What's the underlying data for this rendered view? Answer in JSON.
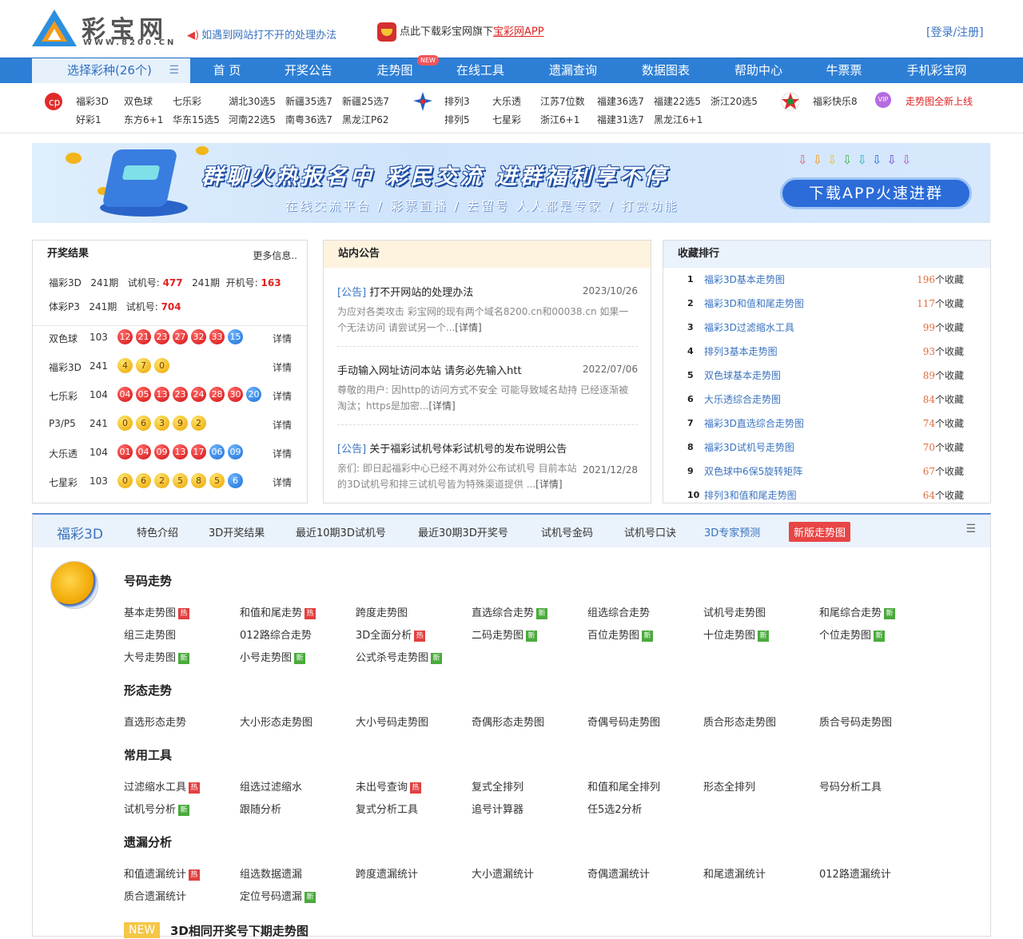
{
  "header": {
    "logo_name": "彩宝网",
    "logo_url": "WWW.8200.CN",
    "notice": "如遇到网站打不开的处理办法",
    "app_text": "点此下载彩宝网旗下",
    "app_link": "宝彩网APP",
    "login": "[登录/注册]"
  },
  "nav": {
    "selector": "选择彩种(26个)",
    "items": [
      "首 页",
      "开奖公告",
      "走势图",
      "在线工具",
      "遗漏查询",
      "数据图表",
      "帮助中心",
      "牛票票",
      "手机彩宝网"
    ],
    "new_badge": "NEW"
  },
  "lottery_row": {
    "group1": [
      [
        "福彩3D",
        "双色球",
        "七乐彩",
        "湖北30选5",
        "新疆35选7",
        "新疆25选7"
      ],
      [
        "好彩1",
        "东方6+1",
        "华东15选5",
        "河南22选5",
        "南粤36选7",
        "黑龙江P62"
      ]
    ],
    "group2": [
      [
        "排列3",
        "大乐透",
        "江苏7位数",
        "福建36选7",
        "福建22选5",
        "浙江20选5"
      ],
      [
        "排列5",
        "七星彩",
        "浙江6+1",
        "福建31选7",
        "黑龙江6+1"
      ]
    ],
    "group3": [
      "福彩快乐8"
    ],
    "promo": "走势图全新上线",
    "vip": "VIP"
  },
  "banner": {
    "title": "群聊火热报名中  彩民交流  进群福利享不停",
    "subtitle": "在线交流平台 / 彩票直播 / 去留号 人人都是专家 / 打赏功能",
    "cta": "下载APP火速进群"
  },
  "results": {
    "title": "开奖结果",
    "more": "更多信息..",
    "line1": {
      "name": "福彩3D",
      "issue1": "241期",
      "label1": "试机号:",
      "val1": "477",
      "issue2": "241期",
      "label2": "开机号:",
      "val2": "163"
    },
    "line2": {
      "name": "体彩P3",
      "issue1": "241期",
      "label1": "试机号:",
      "val1": "704"
    },
    "draws": [
      {
        "name": "双色球",
        "issue": "103",
        "red": [
          "12",
          "21",
          "23",
          "27",
          "32",
          "33"
        ],
        "blue": [
          "15"
        ],
        "style": "red",
        "detail": "详情"
      },
      {
        "name": "福彩3D",
        "issue": "241",
        "red": [
          "4",
          "7",
          "0"
        ],
        "blue": [],
        "style": "yel",
        "detail": "详情"
      },
      {
        "name": "七乐彩",
        "issue": "104",
        "red": [
          "04",
          "05",
          "13",
          "23",
          "24",
          "28",
          "30"
        ],
        "blue": [
          "20"
        ],
        "style": "red",
        "detail": "详情"
      },
      {
        "name": "P3/P5",
        "issue": "241",
        "red": [
          "0",
          "6",
          "3",
          "9",
          "2"
        ],
        "blue": [],
        "style": "yel",
        "detail": "详情"
      },
      {
        "name": "大乐透",
        "issue": "104",
        "red": [
          "01",
          "04",
          "09",
          "13",
          "17"
        ],
        "blue": [
          "06",
          "09"
        ],
        "style": "red",
        "detail": "详情"
      },
      {
        "name": "七星彩",
        "issue": "103",
        "red": [
          "0",
          "6",
          "2",
          "5",
          "8",
          "5"
        ],
        "blue": [
          "6"
        ],
        "style": "yel",
        "detail": "详情"
      }
    ]
  },
  "notices": {
    "title": "站内公告",
    "articles": [
      {
        "prefix": "[公告]",
        "title": "打不开网站的处理办法",
        "date": "2023/10/26",
        "excerpt": "为应对各类攻击 彩宝网的现有两个域名8200.cn和00038.cn 如果一个无法访问 请尝试另一个...",
        "link": "[详情]"
      },
      {
        "prefix": "",
        "title": "手动输入网址访问本站 请务必先输入htt",
        "date": "2022/07/06",
        "excerpt": "尊敬的用户: 因http的访问方式不安全 可能导致域名劫持 已经逐渐被淘汰；https是加密...",
        "link": "[详情]"
      },
      {
        "prefix": "[公告]",
        "title": "关于福彩试机号体彩试机号的发布说明公告",
        "date": "2021/12/28",
        "excerpt": "亲们:  即日起福彩中心已经不再对外公布试机号 目前本站的3D试机号和排三试机号皆为特殊渠道提供 ...",
        "link": "[详情]"
      }
    ]
  },
  "ranking": {
    "title": "收藏排行",
    "suffix": "个收藏",
    "items": [
      {
        "no": "1",
        "name": "福彩3D基本走势图",
        "count": "196"
      },
      {
        "no": "2",
        "name": "福彩3D和值和尾走势图",
        "count": "117"
      },
      {
        "no": "3",
        "name": "福彩3D过滤缩水工具",
        "count": "99"
      },
      {
        "no": "4",
        "name": "排列3基本走势图",
        "count": "93"
      },
      {
        "no": "5",
        "name": "双色球基本走势图",
        "count": "89"
      },
      {
        "no": "6",
        "name": "大乐透综合走势图",
        "count": "84"
      },
      {
        "no": "7",
        "name": "福彩3D直选综合走势图",
        "count": "74"
      },
      {
        "no": "8",
        "name": "福彩3D试机号走势图",
        "count": "70"
      },
      {
        "no": "9",
        "name": "双色球中6保5旋转矩阵",
        "count": "67"
      },
      {
        "no": "10",
        "name": "排列3和值和尾走势图",
        "count": "64"
      }
    ]
  },
  "section": {
    "tabs": [
      "福彩3D",
      "特色介绍",
      "3D开奖结果",
      "最近10期3D试机号",
      "最近30期3D开奖号",
      "试机号金码",
      "试机号口诀",
      "3D专家预测",
      "新版走势图"
    ],
    "groups": [
      {
        "title": "号码走势",
        "links": [
          [
            "基本走势图",
            "hot"
          ],
          [
            "和值和尾走势",
            "hot"
          ],
          [
            "跨度走势图",
            ""
          ],
          [
            "直选综合走势",
            "new"
          ],
          [
            "组选综合走势",
            ""
          ],
          [
            "试机号走势图",
            ""
          ],
          [
            "和尾综合走势",
            "new"
          ],
          [
            "组三走势图",
            ""
          ],
          [
            "012路综合走势",
            ""
          ],
          [
            "3D全面分析",
            "hot"
          ],
          [
            "二码走势图",
            "new"
          ],
          [
            "百位走势图",
            "new"
          ],
          [
            "十位走势图",
            "new"
          ],
          [
            "个位走势图",
            "new"
          ],
          [
            "大号走势图",
            "new"
          ],
          [
            "小号走势图",
            "new"
          ],
          [
            "公式杀号走势图",
            "new"
          ]
        ]
      },
      {
        "title": "形态走势",
        "links": [
          [
            "直选形态走势",
            ""
          ],
          [
            "大小形态走势图",
            ""
          ],
          [
            "大小号码走势图",
            ""
          ],
          [
            "奇偶形态走势图",
            ""
          ],
          [
            "奇偶号码走势图",
            ""
          ],
          [
            "质合形态走势图",
            ""
          ],
          [
            "质合号码走势图",
            ""
          ]
        ]
      },
      {
        "title": "常用工具",
        "links": [
          [
            "过滤缩水工具",
            "hot"
          ],
          [
            "组选过滤缩水",
            ""
          ],
          [
            "未出号查询",
            "hot"
          ],
          [
            "复式全排列",
            ""
          ],
          [
            "和值和尾全排列",
            ""
          ],
          [
            "形态全排列",
            ""
          ],
          [
            "号码分析工具",
            ""
          ],
          [
            "试机号分析",
            "new"
          ],
          [
            "跟随分析",
            ""
          ],
          [
            "复式分析工具",
            ""
          ],
          [
            "追号计算器",
            ""
          ],
          [
            "任5选2分析",
            ""
          ]
        ]
      },
      {
        "title": "遗漏分析",
        "links": [
          [
            "和值遗漏统计",
            "hot"
          ],
          [
            "组选数据遗漏",
            ""
          ],
          [
            "跨度遗漏统计",
            ""
          ],
          [
            "大小遗漏统计",
            ""
          ],
          [
            "奇偶遗漏统计",
            ""
          ],
          [
            "和尾遗漏统计",
            ""
          ],
          [
            "012路遗漏统计",
            ""
          ],
          [
            "质合遗漏统计",
            ""
          ],
          [
            "定位号码遗漏",
            "new"
          ]
        ]
      }
    ],
    "bottom_badge": "NEW",
    "bottom_title": "3D相同开奖号下期走势图",
    "tag_hot": "热",
    "tag_new": "新"
  }
}
